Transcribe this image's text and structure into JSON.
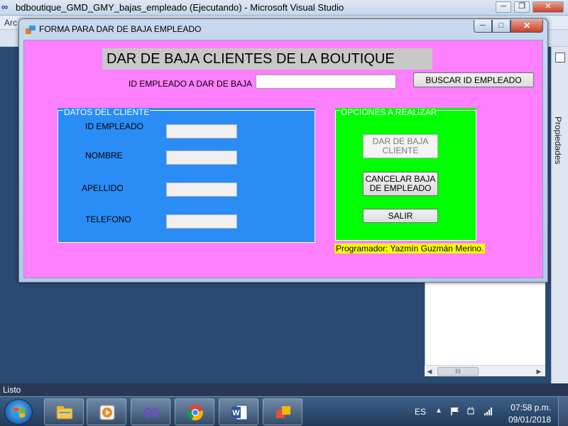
{
  "ide": {
    "logo_text": "∞",
    "title": "bdboutique_GMD_GMY_bajas_empleado (Ejecutando) - Microsoft Visual Studio",
    "menu_fragment": "Arc",
    "status": "Listo",
    "side_panel_label": "Propiedades",
    "controls": {
      "minimize": "─",
      "restore": "❐",
      "close": "✕"
    },
    "scroll_thumb": "III"
  },
  "form": {
    "title": "FORMA PARA DAR DE BAJA EMPLEADO",
    "icon": "form-app-icon",
    "window_controls": {
      "minimize": "─",
      "maximize": "□",
      "close": "✕"
    },
    "heading": "DAR DE BAJA CLIENTES DE LA BOUTIQUE",
    "search_label": "ID EMPLEADO A DAR DE BAJA",
    "search_value": "",
    "search_button": "BUSCAR ID EMPLEADO",
    "client_group": {
      "title": "DATOS DEL CLIENTE",
      "fields": [
        {
          "label": "ID EMPLEADO",
          "value": ""
        },
        {
          "label": "NOMBRE",
          "value": ""
        },
        {
          "label": "APELLIDO",
          "value": ""
        },
        {
          "label": "TELEFONO",
          "value": ""
        }
      ]
    },
    "options_group": {
      "title": "OPCIONES A REALIZAR",
      "buttons": [
        {
          "label": "DAR DE BAJA CLIENTE",
          "enabled": false
        },
        {
          "label": "CANCELAR BAJA DE EMPLEADO",
          "enabled": true
        },
        {
          "label": "SALIR",
          "enabled": true
        }
      ]
    },
    "programmer": "Programador: Yazmín Guzmán Merino."
  },
  "taskbar": {
    "items": [
      "start-orb-icon",
      "file-explorer-icon",
      "media-player-icon",
      "visual-studio-icon",
      "chrome-icon",
      "word-icon",
      "running-app-icon"
    ],
    "language": "ES",
    "time": "07:58 p.m.",
    "date": "09/01/2018"
  },
  "colors": {
    "form_background": "#ff80ff",
    "client_group": "#2a8cf5",
    "options_group": "#00ff00",
    "programmer_label": "#ffff00",
    "heading_background": "#c8c8c8"
  }
}
